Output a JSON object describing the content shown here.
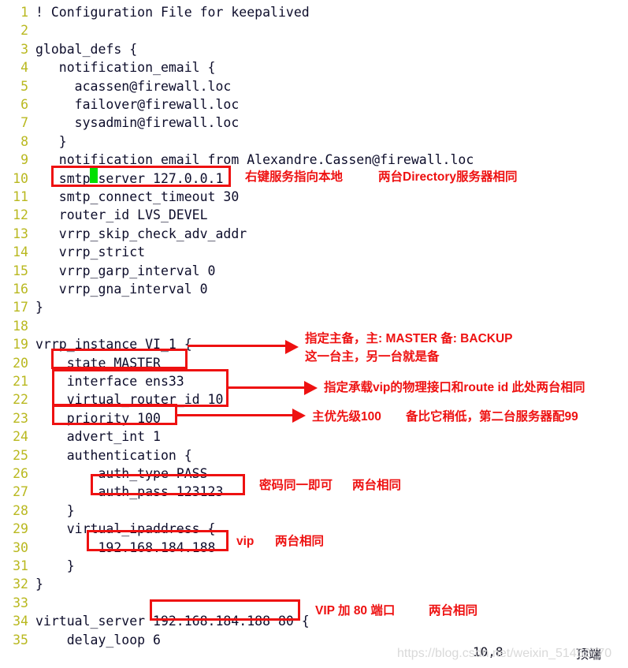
{
  "editor": {
    "cursor_position_label": "10,8",
    "scroll_location_label": "顶端",
    "cursor_line": 10,
    "cursor_col": 8,
    "lines": [
      {
        "n": "1",
        "text": "! Configuration File for keepalived"
      },
      {
        "n": "2",
        "text": ""
      },
      {
        "n": "3",
        "text": "global_defs {"
      },
      {
        "n": "4",
        "text": "   notification_email {"
      },
      {
        "n": "5",
        "text": "     acassen@firewall.loc"
      },
      {
        "n": "6",
        "text": "     failover@firewall.loc"
      },
      {
        "n": "7",
        "text": "     sysadmin@firewall.loc"
      },
      {
        "n": "8",
        "text": "   }"
      },
      {
        "n": "9",
        "text": "   notification_email_from Alexandre.Cassen@firewall.loc"
      },
      {
        "n": "10",
        "text": "   smtp_server 127.0.0.1"
      },
      {
        "n": "11",
        "text": "   smtp_connect_timeout 30"
      },
      {
        "n": "12",
        "text": "   router_id LVS_DEVEL"
      },
      {
        "n": "13",
        "text": "   vrrp_skip_check_adv_addr"
      },
      {
        "n": "14",
        "text": "   vrrp_strict"
      },
      {
        "n": "15",
        "text": "   vrrp_garp_interval 0"
      },
      {
        "n": "16",
        "text": "   vrrp_gna_interval 0"
      },
      {
        "n": "17",
        "text": "}"
      },
      {
        "n": "18",
        "text": ""
      },
      {
        "n": "19",
        "text": "vrrp_instance VI_1 {"
      },
      {
        "n": "20",
        "text": "    state MASTER"
      },
      {
        "n": "21",
        "text": "    interface ens33"
      },
      {
        "n": "22",
        "text": "    virtual_router_id 10"
      },
      {
        "n": "23",
        "text": "    priority 100"
      },
      {
        "n": "24",
        "text": "    advert_int 1"
      },
      {
        "n": "25",
        "text": "    authentication {"
      },
      {
        "n": "26",
        "text": "        auth_type PASS"
      },
      {
        "n": "27",
        "text": "        auth_pass 123123"
      },
      {
        "n": "28",
        "text": "    }"
      },
      {
        "n": "29",
        "text": "    virtual_ipaddress {"
      },
      {
        "n": "30",
        "text": "        192.168.184.188"
      },
      {
        "n": "31",
        "text": "    }"
      },
      {
        "n": "32",
        "text": "}"
      },
      {
        "n": "33",
        "text": ""
      },
      {
        "n": "34",
        "text": "virtual_server 192.168.184.188 80 {"
      },
      {
        "n": "35",
        "text": "    delay_loop 6"
      }
    ]
  },
  "annotations": {
    "smtp_server_note": "右键服务指向本地",
    "smtp_server_note2": "两台Directory服务器相同",
    "state_note_line1": "指定主备，主: MASTER 备: BACKUP",
    "state_note_line2": "这一台主，另一台就是备",
    "interface_note": "指定承载vip的物理接口和route id 此处两台相同",
    "priority_note": "主优先级100",
    "priority_note2": "备比它稍低，第二台服务器配99",
    "auth_pass_note": "密码同一即可",
    "auth_pass_note2": "两台相同",
    "vip_note": "vip",
    "vip_note2": "两台相同",
    "virtual_server_note": "VIP 加 80 端口",
    "virtual_server_note2": "两台相同"
  },
  "watermark": {
    "text": "https://blog.csdn.net/weixin_51452770"
  },
  "colors": {
    "annotation_red": "#ee1111",
    "line_number": "#b9b81f",
    "code_text": "#0d0d2b",
    "cursor_green": "#00e000",
    "background": "#ffffff"
  }
}
